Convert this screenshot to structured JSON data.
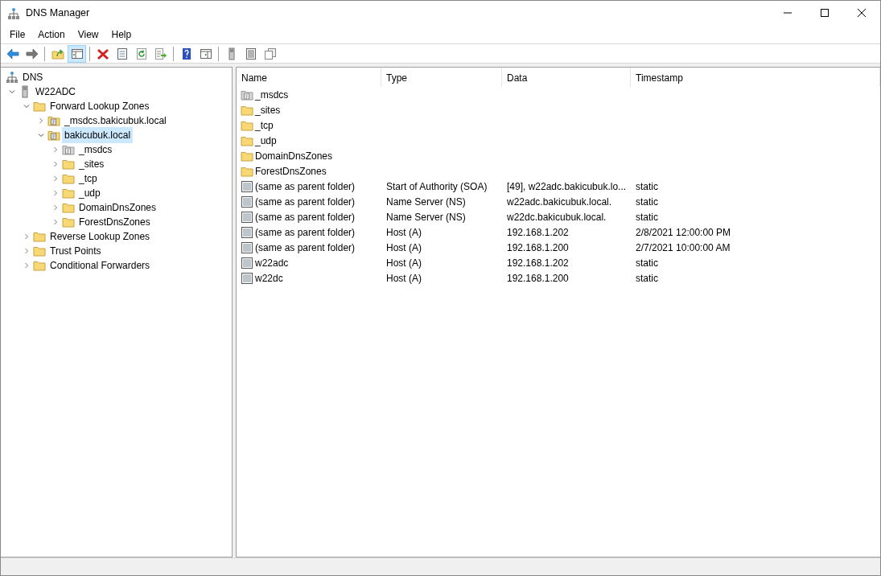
{
  "window": {
    "title": "DNS Manager"
  },
  "menu": [
    "File",
    "Action",
    "View",
    "Help"
  ],
  "toolbar": [
    {
      "kind": "back",
      "pressed": false
    },
    {
      "kind": "forward",
      "pressed": false
    },
    {
      "kind": "sep"
    },
    {
      "kind": "up",
      "pressed": false
    },
    {
      "kind": "tree",
      "pressed": true
    },
    {
      "kind": "sep"
    },
    {
      "kind": "delete",
      "pressed": false
    },
    {
      "kind": "properties",
      "pressed": false
    },
    {
      "kind": "refresh",
      "pressed": false
    },
    {
      "kind": "export",
      "pressed": false
    },
    {
      "kind": "sep"
    },
    {
      "kind": "help",
      "pressed": false
    },
    {
      "kind": "pane",
      "pressed": false
    },
    {
      "kind": "sep"
    },
    {
      "kind": "server",
      "pressed": false
    },
    {
      "kind": "list",
      "pressed": false
    },
    {
      "kind": "copy",
      "pressed": false
    }
  ],
  "tree": [
    {
      "label": "DNS",
      "kind": "dns",
      "selected": false,
      "children": [
        {
          "label": "W22ADC",
          "kind": "server",
          "expanded": true,
          "selected": false,
          "children": [
            {
              "label": "Forward Lookup Zones",
              "kind": "folder",
              "expanded": true,
              "selected": false,
              "children": [
                {
                  "label": "_msdcs.bakicubuk.local",
                  "kind": "zone",
                  "expanded": false,
                  "selected": false
                },
                {
                  "label": "bakicubuk.local",
                  "kind": "zone",
                  "expanded": true,
                  "selected": true,
                  "children": [
                    {
                      "label": "_msdcs",
                      "kind": "zone-grey",
                      "expanded": false,
                      "selected": false
                    },
                    {
                      "label": "_sites",
                      "kind": "folder",
                      "expanded": false,
                      "selected": false
                    },
                    {
                      "label": "_tcp",
                      "kind": "folder",
                      "expanded": false,
                      "selected": false
                    },
                    {
                      "label": "_udp",
                      "kind": "folder",
                      "expanded": false,
                      "selected": false
                    },
                    {
                      "label": "DomainDnsZones",
                      "kind": "folder",
                      "expanded": false,
                      "selected": false
                    },
                    {
                      "label": "ForestDnsZones",
                      "kind": "folder",
                      "expanded": false,
                      "selected": false
                    }
                  ]
                }
              ]
            },
            {
              "label": "Reverse Lookup Zones",
              "kind": "folder",
              "expanded": false,
              "selected": false
            },
            {
              "label": "Trust Points",
              "kind": "folder",
              "expanded": false,
              "selected": false
            },
            {
              "label": "Conditional Forwarders",
              "kind": "folder",
              "expanded": false,
              "selected": false
            }
          ]
        }
      ]
    }
  ],
  "table": {
    "columns": [
      "Name",
      "Type",
      "Data",
      "Timestamp"
    ],
    "rows": [
      {
        "kind": "zone-grey",
        "cells": [
          "_msdcs",
          "",
          "",
          ""
        ]
      },
      {
        "kind": "folder",
        "cells": [
          "_sites",
          "",
          "",
          ""
        ]
      },
      {
        "kind": "folder",
        "cells": [
          "_tcp",
          "",
          "",
          ""
        ]
      },
      {
        "kind": "folder",
        "cells": [
          "_udp",
          "",
          "",
          ""
        ]
      },
      {
        "kind": "folder",
        "cells": [
          "DomainDnsZones",
          "",
          "",
          ""
        ]
      },
      {
        "kind": "folder",
        "cells": [
          "ForestDnsZones",
          "",
          "",
          ""
        ]
      },
      {
        "kind": "record",
        "cells": [
          "(same as parent folder)",
          "Start of Authority (SOA)",
          "[49], w22adc.bakicubuk.lo...",
          "static"
        ]
      },
      {
        "kind": "record",
        "cells": [
          "(same as parent folder)",
          "Name Server (NS)",
          "w22adc.bakicubuk.local.",
          "static"
        ]
      },
      {
        "kind": "record",
        "cells": [
          "(same as parent folder)",
          "Name Server (NS)",
          "w22dc.bakicubuk.local.",
          "static"
        ]
      },
      {
        "kind": "record",
        "cells": [
          "(same as parent folder)",
          "Host (A)",
          "192.168.1.202",
          "2/8/2021 12:00:00 PM"
        ]
      },
      {
        "kind": "record",
        "cells": [
          "(same as parent folder)",
          "Host (A)",
          "192.168.1.200",
          "2/7/2021 10:00:00 AM"
        ]
      },
      {
        "kind": "record",
        "cells": [
          "w22adc",
          "Host (A)",
          "192.168.1.202",
          "static"
        ]
      },
      {
        "kind": "record",
        "cells": [
          "w22dc",
          "Host (A)",
          "192.168.1.200",
          "static"
        ]
      }
    ]
  }
}
